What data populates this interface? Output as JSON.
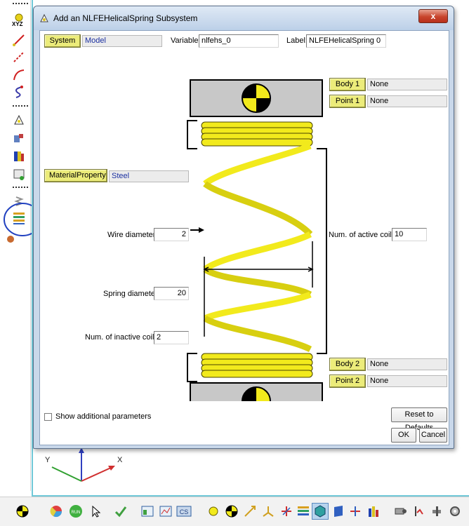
{
  "left_toolbar": {
    "xyz_label": "XYZ",
    "icons": [
      "point-icon",
      "line-icon",
      "polyline-icon",
      "curve-icon",
      "spline-icon",
      "marker-icon",
      "body-icon",
      "graphic-icon",
      "joint-icon",
      "spring-icon",
      "nlfe-spring-icon",
      "contact-icon"
    ]
  },
  "dialog": {
    "title": "Add an NLFEHelicalSpring Subsystem",
    "close_label": "x",
    "system_button": "System",
    "system_value": "Model",
    "variable_label": "Variable:",
    "variable_value": "nlfehs_0",
    "label_label": "Label:",
    "label_value": "NLFEHelicalSpring 0",
    "material_button": "MaterialProperty",
    "material_value": "Steel",
    "body1_button": "Body 1",
    "body1_value": "None",
    "point1_button": "Point 1",
    "point1_value": "None",
    "body2_button": "Body 2",
    "body2_value": "None",
    "point2_button": "Point 2",
    "point2_value": "None",
    "wire_diameter_label": "Wire diameter:",
    "wire_diameter_value": "2",
    "spring_diameter_label": "Spring diameter:",
    "spring_diameter_value": "20",
    "inactive_coils_label": "Num. of inactive coils:",
    "inactive_coils_value": "2",
    "active_coils_label": "Num. of active coils:",
    "active_coils_value": "10",
    "show_additional_label": "Show additional parameters",
    "reset_label": "Reset to Defaults",
    "ok_label": "OK",
    "cancel_label": "Cancel"
  },
  "triad": {
    "y_label": "Y",
    "x_label": "X"
  },
  "colors": {
    "spring": "#f2ea1c",
    "button_yellow": "#ecec7a",
    "dialog_frame": "#c9d8ea",
    "value_blue": "#1a2fa0"
  }
}
